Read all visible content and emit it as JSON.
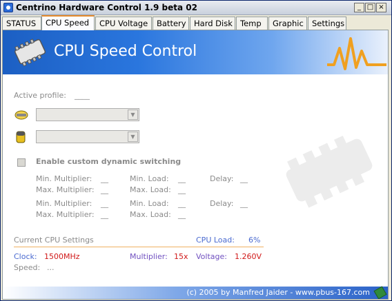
{
  "window": {
    "title": "Centrino Hardware Control 1.9 beta 02",
    "minimize_icon": "minimize-icon",
    "maximize_icon": "maximize-icon",
    "close_icon": "close-icon"
  },
  "tabs": [
    {
      "label": "STATUS"
    },
    {
      "label": "CPU Speed",
      "active": true
    },
    {
      "label": "CPU Voltage"
    },
    {
      "label": "Battery"
    },
    {
      "label": "Hard Disk"
    },
    {
      "label": "Temp"
    },
    {
      "label": "Graphic"
    },
    {
      "label": "Settings"
    }
  ],
  "banner": {
    "title": "CPU Speed Control",
    "icon": "cpu-chip-icon"
  },
  "profile": {
    "label": "Active profile:",
    "value": "____"
  },
  "ac_combo": {
    "value": "",
    "icon": "ac-plug-icon"
  },
  "battery_combo": {
    "value": "",
    "icon": "battery-icon"
  },
  "custom_switching": {
    "label": "Enable custom dynamic switching",
    "checked": false
  },
  "rows": [
    {
      "min_mult_label": "Min. Multiplier:",
      "min_mult_value": "__",
      "min_load_label": "Min. Load:",
      "min_load_value": "__",
      "delay_label": "Delay:",
      "delay_value": "__",
      "max_mult_label": "Max. Multiplier:",
      "max_mult_value": "__",
      "max_load_label": "Max. Load:",
      "max_load_value": "__"
    },
    {
      "min_mult_label": "Min. Multiplier:",
      "min_mult_value": "__",
      "min_load_label": "Min. Load:",
      "min_load_value": "__",
      "delay_label": "Delay:",
      "delay_value": "__",
      "max_mult_label": "Max. Multiplier:",
      "max_mult_value": "__",
      "max_load_label": "Max. Load:",
      "max_load_value": "__"
    }
  ],
  "current": {
    "section_label": "Current CPU Settings",
    "cpu_load_label": "CPU Load:",
    "cpu_load_value": "6%",
    "clock_label": "Clock:",
    "clock_value": "1500MHz",
    "multiplier_label": "Multiplier:",
    "multiplier_value": "15x",
    "voltage_label": "Voltage:",
    "voltage_value": "1.260V",
    "speed_label": "Speed:",
    "speed_value": "..."
  },
  "footer": {
    "text": "(c) 2005 by Manfred Jaider  -  www.pbus-167.com",
    "icon": "chip-small-icon"
  },
  "colors": {
    "banner_blue": "#2a76de",
    "accent_orange": "#f0a020",
    "value_red": "#d01818",
    "label_blue": "#4a6ad0"
  }
}
